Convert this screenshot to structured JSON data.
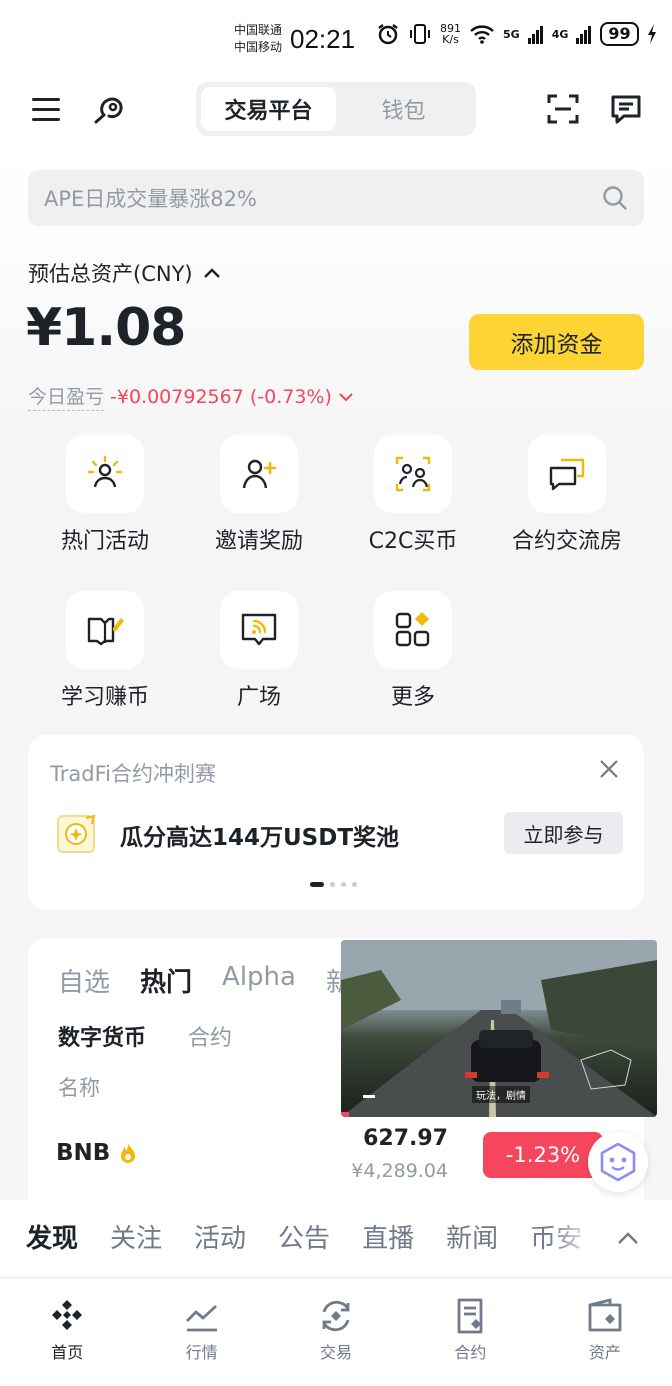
{
  "status_bar": {
    "carrier1": "中国联通",
    "carrier2": "中国移动",
    "time": "02:21",
    "net_speed_value": "891",
    "net_speed_unit": "K/s",
    "signal1": "5G",
    "signal2": "4G",
    "battery": "99"
  },
  "header": {
    "tabs": [
      {
        "label": "交易平台",
        "active": true
      },
      {
        "label": "钱包",
        "active": false
      }
    ]
  },
  "search": {
    "placeholder": "APE日成交量暴涨82%"
  },
  "asset": {
    "label": "预估总资产(CNY)",
    "value": "¥1.08",
    "add_funds": "添加资金",
    "pnl_label": "今日盈亏",
    "pnl_value": "-¥0.00792567 (-0.73%)"
  },
  "shortcuts": [
    {
      "label": "热门活动",
      "icon": "sun-person-icon"
    },
    {
      "label": "邀请奖励",
      "icon": "add-user-icon"
    },
    {
      "label": "C2C买币",
      "icon": "c2c-users-icon"
    },
    {
      "label": "合约交流房",
      "icon": "chat-bubbles-icon"
    },
    {
      "label": "学习赚币",
      "icon": "book-pen-icon"
    },
    {
      "label": "广场",
      "icon": "broadcast-icon"
    },
    {
      "label": "更多",
      "icon": "more-grid-icon"
    }
  ],
  "promo": {
    "title": "TradFi合约冲刺赛",
    "text": "瓜分高达144万USDT奖池",
    "button": "立即参与"
  },
  "market": {
    "tabs": [
      {
        "label": "自选",
        "active": false
      },
      {
        "label": "热门",
        "active": true
      },
      {
        "label": "Alpha",
        "active": false
      },
      {
        "label": "新",
        "active": false
      }
    ],
    "subtabs": [
      {
        "label": "数字货币",
        "active": true
      },
      {
        "label": "合约",
        "active": false
      }
    ],
    "column_name": "名称",
    "rows": [
      {
        "symbol": "BNB",
        "price": "627.97",
        "price_cny": "¥4,289.04",
        "change": "-1.23%"
      }
    ]
  },
  "video": {
    "caption": "玩法，剧情"
  },
  "discover_tabs": [
    "发现",
    "关注",
    "活动",
    "公告",
    "直播",
    "新闻",
    "币安"
  ],
  "bottom_nav": [
    {
      "label": "首页",
      "icon": "home-logo-icon",
      "active": true
    },
    {
      "label": "行情",
      "icon": "chart-icon",
      "active": false
    },
    {
      "label": "交易",
      "icon": "trade-icon",
      "active": false
    },
    {
      "label": "合约",
      "icon": "futures-icon",
      "active": false
    },
    {
      "label": "资产",
      "icon": "wallet-icon",
      "active": false
    }
  ],
  "colors": {
    "accent": "#fcd535",
    "down": "#f6465d",
    "text": "#1e2329",
    "muted": "#929aa5"
  }
}
